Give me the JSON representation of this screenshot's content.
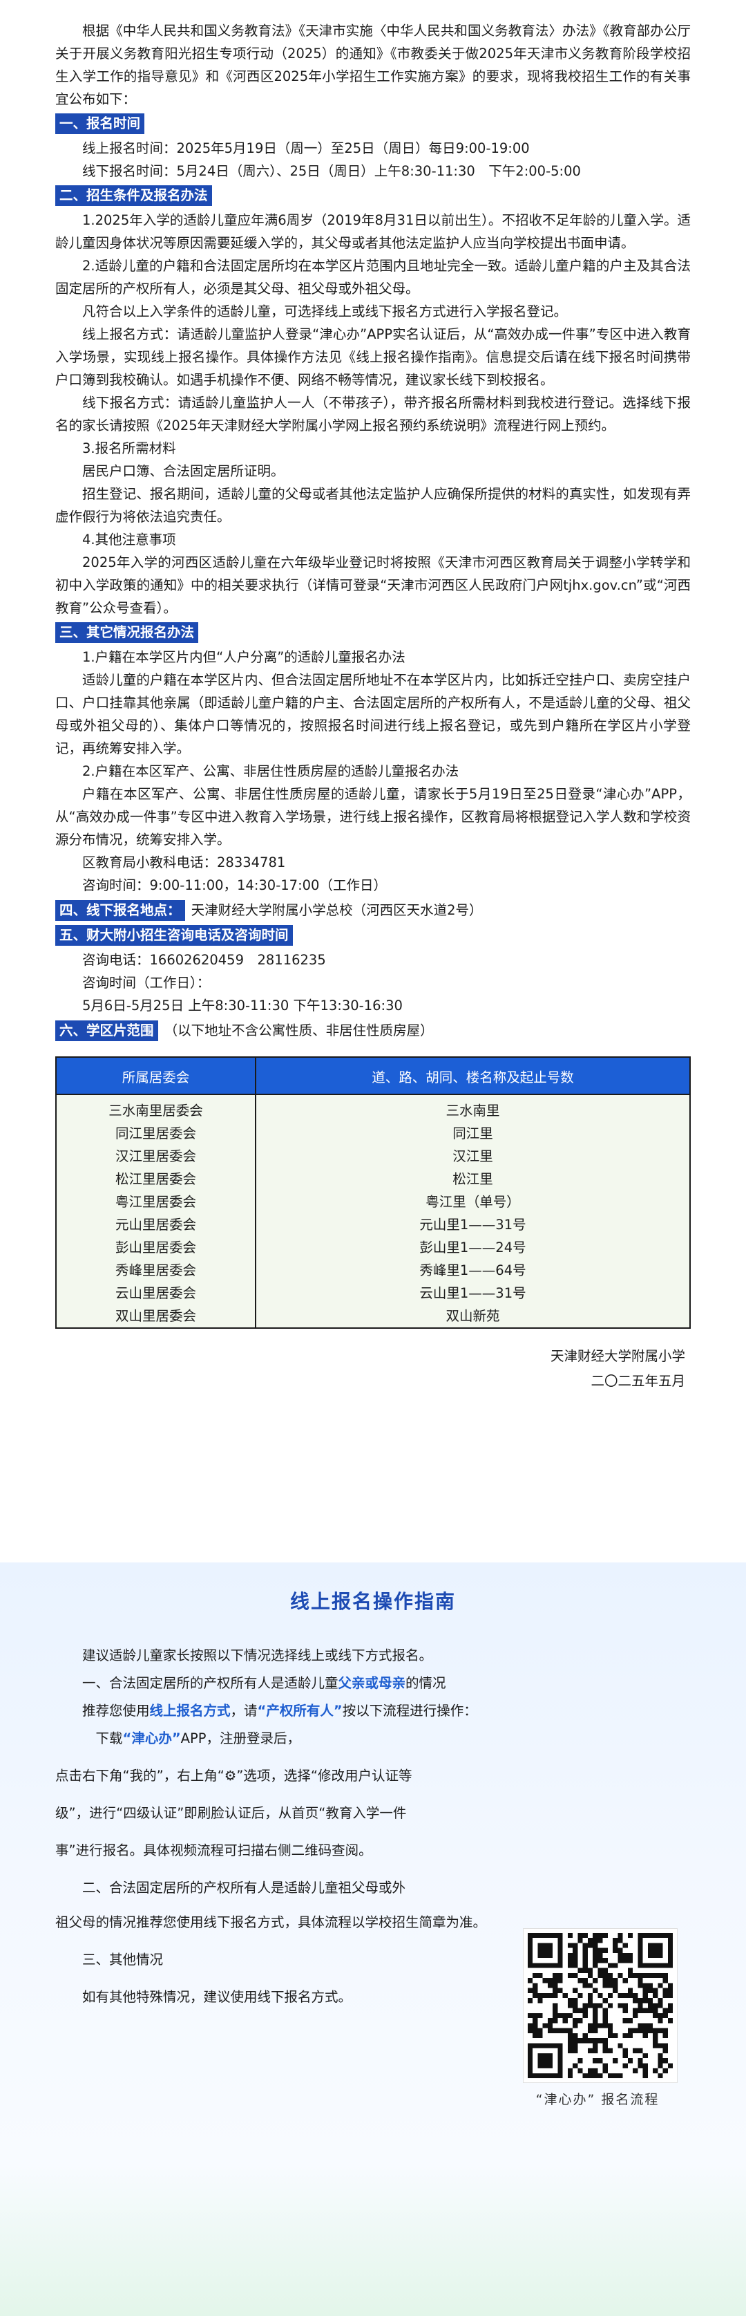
{
  "intro": "根据《中华人民共和国义务教育法》《天津市实施〈中华人民共和国义务教育法〉办法》《教育部办公厅关于开展义务教育阳光招生专项行动（2025）的通知》《市教委关于做2025年天津市义务教育阶段学校招生入学工作的指导意见》和《河西区2025年小学招生工作实施方案》的要求，现将我校招生工作的有关事宜公布如下：",
  "s1": {
    "title": "一、报名时间",
    "online": "线上报名时间：2025年5月19日（周一）至25日（周日）每日9:00-19:00",
    "offline": "线下报名时间：5月24日（周六）、25日（周日）上午8:30-11:30　下午2:00-5:00"
  },
  "s2": {
    "title": "二、招生条件及报名办法",
    "p1": "1.2025年入学的适龄儿童应年满6周岁（2019年8月31日以前出生）。不招收不足年龄的儿童入学。适龄儿童因身体状况等原因需要延缓入学的，其父母或者其他法定监护人应当向学校提出书面申请。",
    "p2": "2.适龄儿童的户籍和合法固定居所均在本学区片范围内且地址完全一致。适龄儿童户籍的户主及其合法固定居所的产权所有人，必须是其父母、祖父母或外祖父母。",
    "p3": "凡符合以上入学条件的适龄儿童，可选择线上或线下报名方式进行入学报名登记。",
    "p4": "线上报名方式：请适龄儿童监护人登录“津心办”APP实名认证后，从“高效办成一件事”专区中进入教育入学场景，实现线上报名操作。具体操作方法见《线上报名操作指南》。信息提交后请在线下报名时间携带户口簿到我校确认。如遇手机操作不便、网络不畅等情况，建议家长线下到校报名。",
    "p5": "线下报名方式：请适龄儿童监护人一人（不带孩子），带齐报名所需材料到我校进行登记。选择线下报名的家长请按照《2025年天津财经大学附属小学网上报名预约系统说明》流程进行网上预约。",
    "p6": "3.报名所需材料",
    "p7": "居民户口簿、合法固定居所证明。",
    "p8": "招生登记、报名期间，适龄儿童的父母或者其他法定监护人应确保所提供的材料的真实性，如发现有弄虚作假行为将依法追究责任。",
    "p9": "4.其他注意事项",
    "p10": "2025年入学的河西区适龄儿童在六年级毕业登记时将按照《天津市河西区教育局关于调整小学转学和初中入学政策的通知》中的相关要求执行（详情可登录“天津市河西区人民政府门户网tjhx.gov.cn”或“河西教育”公众号查看）。"
  },
  "s3": {
    "title": "三、其它情况报名办法",
    "p1": "1.户籍在本学区片内但“人户分离”的适龄儿童报名办法",
    "p2": "适龄儿童的户籍在本学区片内、但合法固定居所地址不在本学区片内，比如拆迁空挂户口、卖房空挂户口、户口挂靠其他亲属（即适龄儿童户籍的户主、合法固定居所的产权所有人，不是适龄儿童的父母、祖父母或外祖父母的）、集体户口等情况的，按照报名时间进行线上报名登记，或先到户籍所在学区片小学登记，再统筹安排入学。",
    "p3": "2.户籍在本区军产、公寓、非居住性质房屋的适龄儿童报名办法",
    "p4": "户籍在本区军产、公寓、非居住性质房屋的适龄儿童，请家长于5月19日至25日登录“津心办”APP，从“高效办成一件事”专区中进入教育入学场景，进行线上报名操作，区教育局将根据登记入学人数和学校资源分布情况，统筹安排入学。",
    "phone": "区教育局小教科电话：28334781",
    "hours": "咨询时间：9:00-11:00，14:30-17:00（工作日）"
  },
  "s4": {
    "title": "四、线下报名地点：",
    "text": "天津财经大学附属小学总校（河西区天水道2号）"
  },
  "s5": {
    "title": "五、财大附小招生咨询电话及咨询时间",
    "phone": "咨询电话：16602620459　28116235",
    "hours_label": "咨询时间（工作日）：",
    "hours": "5月6日-5月25日 上午8:30-11:30 下午13:30-16:30"
  },
  "s6": {
    "title": "六、学区片范围",
    "note": "（以下地址不含公寓性质、非居住性质房屋）"
  },
  "table": {
    "headers": [
      "所属居委会",
      "道、路、胡同、楼名称及起止号数"
    ],
    "rows": [
      [
        "三水南里居委会",
        "三水南里"
      ],
      [
        "同江里居委会",
        "同江里"
      ],
      [
        "汉江里居委会",
        "汉江里"
      ],
      [
        "松江里居委会",
        "松江里"
      ],
      [
        "粤江里居委会",
        "粤江里（单号）"
      ],
      [
        "元山里居委会",
        "元山里1——31号"
      ],
      [
        "彭山里居委会",
        "彭山里1——24号"
      ],
      [
        "秀峰里居委会",
        "秀峰里1——64号"
      ],
      [
        "云山里居委会",
        "云山里1——31号"
      ],
      [
        "双山里居委会",
        "双山新苑"
      ]
    ]
  },
  "sign": {
    "school": "天津财经大学附属小学",
    "date": "二〇二五年五月"
  },
  "guide": {
    "title": "线上报名操作指南",
    "l1": "建议适龄儿童家长按照以下情况选择线上或线下方式报名。",
    "l2a": "一、合法固定居所的产权所有人是适龄儿童",
    "l2b": "父亲或母亲",
    "l2c": "的情况",
    "l3a": "推荐您使用",
    "l3b": "线上报名方式",
    "l3c": "，请",
    "l3d": "“产权所有人”",
    "l3e": "按以下流程进行操作：",
    "l4a": "下载",
    "l4b": "“津心办”",
    "l4c": "APP，注册登录后，",
    "l5": "点击右下角“我的”，右上角“⚙”选项，选择“修改用户认证等",
    "l6": "级”，进行“四级认证”即刷脸认证后，从首页“教育入学一件",
    "l7": "事”进行报名。具体视频流程可扫描右侧二维码查阅。",
    "l8": "二、合法固定居所的产权所有人是适龄儿童祖父母或外",
    "l9": "祖父母的情况推荐您使用线下报名方式，具体流程以学校招生简章为准。",
    "l10": "三、其他情况",
    "l11": "如有其他特殊情况，建议使用线下报名方式。",
    "qr_caption": "“津心办” 报名流程"
  },
  "colors": {
    "section_bg": "#1d4bb3",
    "table_header": "#1c5fd6",
    "table_cell": "#f3f8ee",
    "highlight": "#1f5fd0"
  }
}
